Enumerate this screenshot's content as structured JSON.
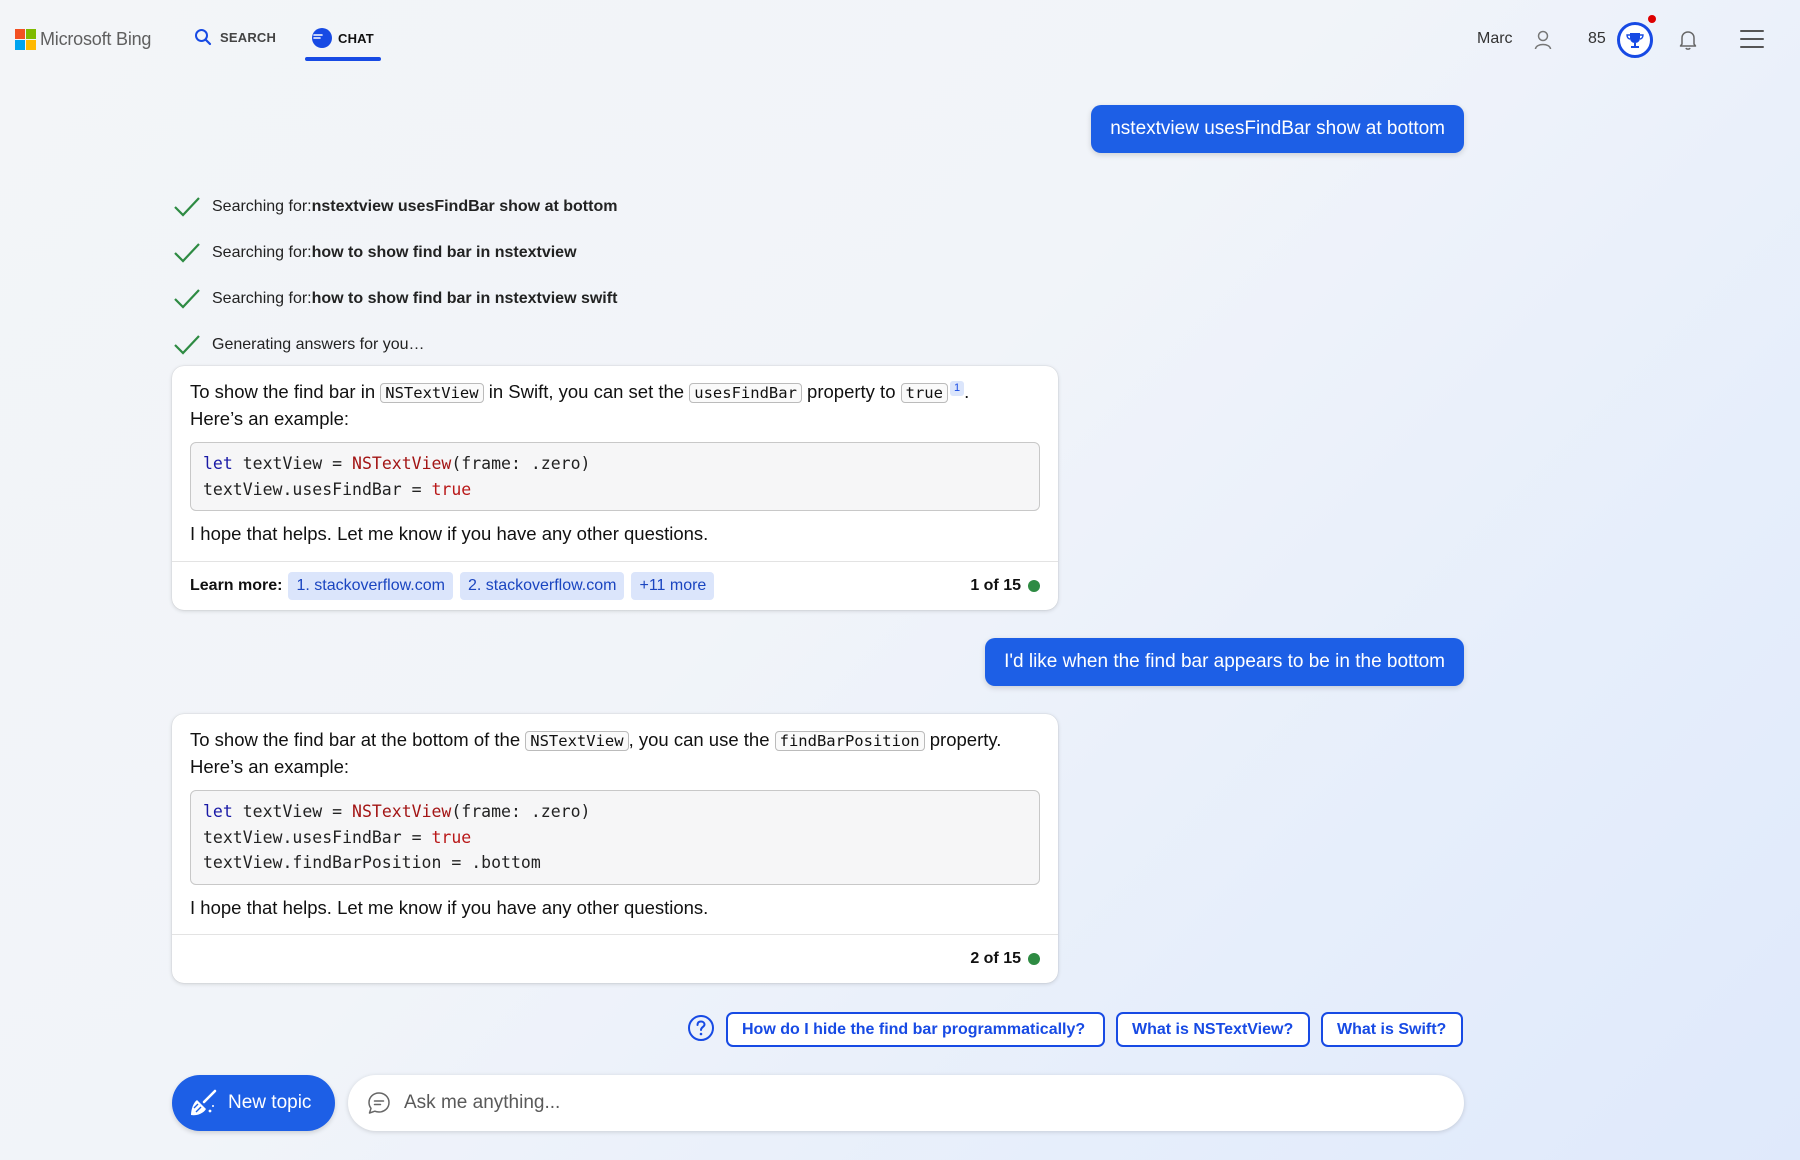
{
  "header": {
    "logo_text": "Microsoft Bing",
    "tabs": [
      {
        "label": "SEARCH",
        "icon": "search-icon",
        "active": false
      },
      {
        "label": "CHAT",
        "icon": "chat-icon",
        "active": true
      }
    ],
    "user_name": "Marc",
    "points": "85",
    "accent_color": "#174ae4"
  },
  "messages": {
    "user_1": "nstextview usesFindBar show at bottom",
    "progress": [
      {
        "prefix": "Searching for: ",
        "query": "nstextview usesFindBar show at bottom"
      },
      {
        "prefix": "Searching for: ",
        "query": "how to show find bar in nstextview"
      },
      {
        "prefix": "Searching for: ",
        "query": "how to show find bar in nstextview swift"
      },
      {
        "prefix": "Generating answers for you…",
        "query": ""
      }
    ],
    "bot_1": {
      "t1": "To show the find bar in ",
      "c1": "NSTextView",
      "t2": " in Swift, you can set the ",
      "c2": "usesFindBar",
      "t3": " property to ",
      "c3": "true",
      "citation": "1",
      "t4": ".",
      "t5": "Here’s an example:",
      "code": {
        "l1_kw": "let",
        "l1_a": " textView = ",
        "l1_type": "NSTextView",
        "l1_b": "(frame: .zero)",
        "l2_a": "textView.usesFindBar = ",
        "l2_bool": "true"
      },
      "after": "I hope that helps. Let me know if you have any other questions.",
      "learn_more_label": "Learn more:",
      "sources": [
        "1. stackoverflow.com",
        "2. stackoverflow.com",
        "+11 more"
      ],
      "counter": "1 of 15"
    },
    "user_2": "I'd like when the find bar appears to be in the bottom",
    "bot_2": {
      "t1": "To show the find bar at the bottom of the ",
      "c1": "NSTextView",
      "t2": ", you can use the ",
      "c2": "findBarPosition",
      "t3": " property.",
      "t4": "Here’s an example:",
      "code": {
        "l1_kw": "let",
        "l1_a": " textView = ",
        "l1_type": "NSTextView",
        "l1_b": "(frame: .zero)",
        "l2_a": "textView.usesFindBar = ",
        "l2_bool": "true",
        "l3": "textView.findBarPosition = .bottom"
      },
      "after": "I hope that helps. Let me know if you have any other questions.",
      "counter": "2 of 15"
    }
  },
  "suggestions": [
    "How do I hide the find bar programmatically?",
    "What is NSTextView?",
    "What is Swift?"
  ],
  "input": {
    "new_topic_label": "New topic",
    "placeholder": "Ask me anything...",
    "value": ""
  },
  "status_color": "#2e8b43"
}
